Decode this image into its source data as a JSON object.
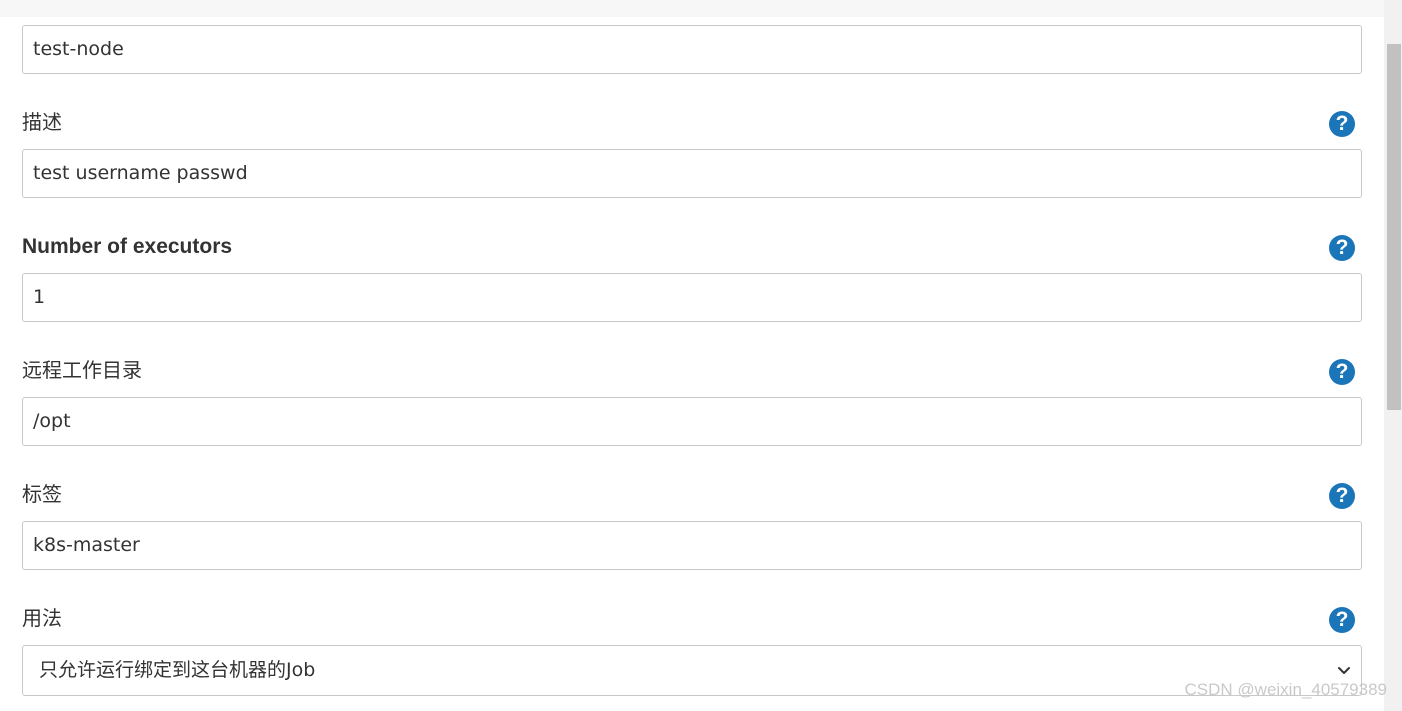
{
  "fields": {
    "name": {
      "value": "test-node"
    },
    "description": {
      "label": "描述",
      "value": "test username passwd",
      "help_icon": "question-circle-icon"
    },
    "executors": {
      "label": "Number of executors",
      "value": "1",
      "help_icon": "question-circle-icon"
    },
    "remote_dir": {
      "label": "远程工作目录",
      "value": "/opt",
      "help_icon": "question-circle-icon"
    },
    "labels": {
      "label": "标签",
      "value": "k8s-master",
      "help_icon": "question-circle-icon"
    },
    "usage": {
      "label": "用法",
      "selected": "只允许运行绑定到这台机器的Job",
      "help_icon": "question-circle-icon",
      "dropdown_icon": "chevron-down-icon"
    }
  },
  "help_glyph": "?",
  "watermark": "CSDN @weixin_40579389",
  "colors": {
    "help_icon": "#1b75b9",
    "input_border": "#c8c8c8",
    "text": "#333333"
  }
}
